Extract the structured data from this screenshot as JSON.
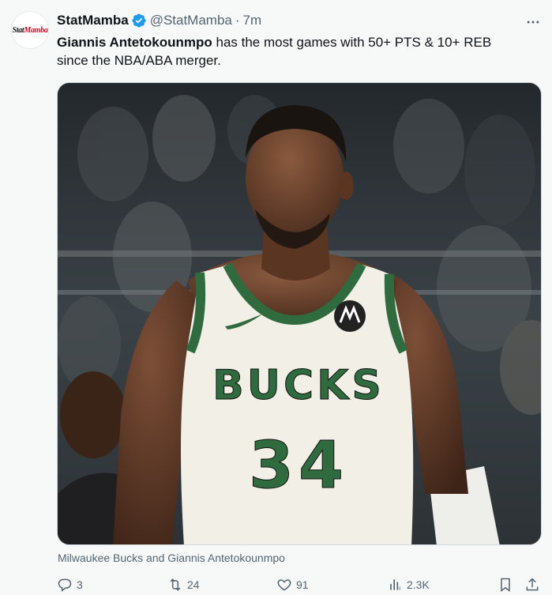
{
  "author": {
    "avatar_text_a": "Stat",
    "avatar_text_b": "Mamba",
    "name": "StatMamba",
    "handle": "@StatMamba",
    "separator": "·",
    "time": "7m",
    "verified_color": "#1d9bf0"
  },
  "tweet": {
    "text_bold": "Giannis Antetokounmpo",
    "text_rest_line1": " has the most games with 50+ PTS & 10+ REB",
    "text_line2": "since the NBA/ABA merger.",
    "caption": "Milwaukee Bucks and Giannis Antetokounmpo",
    "jersey_text": "BUCKS",
    "jersey_number": "34"
  },
  "actions": {
    "reply_count": "3",
    "retweet_count": "24",
    "like_count": "91",
    "view_count": "2.3K"
  },
  "colors": {
    "text": "#0f1419",
    "muted": "#536471",
    "jersey_green": "#2f6b3e",
    "jersey_cream": "#f1efe6"
  }
}
